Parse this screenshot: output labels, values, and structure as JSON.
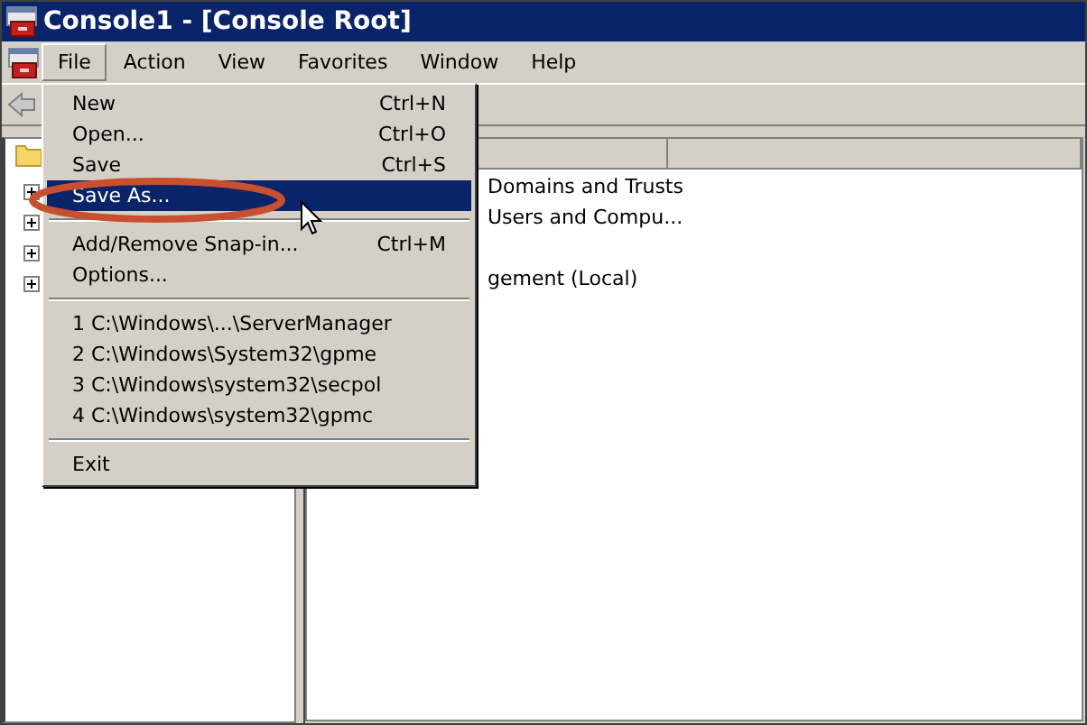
{
  "window": {
    "title": "Console1 - [Console Root]"
  },
  "menubar": [
    {
      "label": "File",
      "selected": true
    },
    {
      "label": "Action",
      "selected": false
    },
    {
      "label": "View",
      "selected": false
    },
    {
      "label": "Favorites",
      "selected": false
    },
    {
      "label": "Window",
      "selected": false
    },
    {
      "label": "Help",
      "selected": false
    }
  ],
  "file_menu": [
    {
      "kind": "item",
      "label": "New",
      "shortcut": "Ctrl+N",
      "highlighted": false
    },
    {
      "kind": "item",
      "label": "Open...",
      "shortcut": "Ctrl+O",
      "highlighted": false
    },
    {
      "kind": "item",
      "label": "Save",
      "shortcut": "Ctrl+S",
      "highlighted": false
    },
    {
      "kind": "item",
      "label": "Save As...",
      "highlighted": true
    },
    {
      "kind": "separator"
    },
    {
      "kind": "item",
      "label": "Add/Remove Snap-in...",
      "shortcut": "Ctrl+M",
      "highlighted": false
    },
    {
      "kind": "item",
      "label": "Options...",
      "highlighted": false
    },
    {
      "kind": "separator"
    },
    {
      "kind": "item",
      "label": "1 C:\\Windows\\...\\ServerManager",
      "highlighted": false
    },
    {
      "kind": "item",
      "label": "2 C:\\Windows\\System32\\gpme",
      "highlighted": false
    },
    {
      "kind": "item",
      "label": "3 C:\\Windows\\system32\\secpol",
      "highlighted": false
    },
    {
      "kind": "item",
      "label": "4 C:\\Windows\\system32\\gpmc",
      "highlighted": false
    },
    {
      "kind": "separator"
    },
    {
      "kind": "item",
      "label": "Exit",
      "highlighted": false
    }
  ],
  "tree": {
    "items": [
      {
        "expanded": false
      },
      {
        "expanded": false
      },
      {
        "expanded": false
      },
      {
        "expanded": false
      }
    ]
  },
  "list": {
    "rows": [
      "Domains and Trusts",
      "Users and Compu...",
      "",
      "gement (Local)"
    ]
  }
}
